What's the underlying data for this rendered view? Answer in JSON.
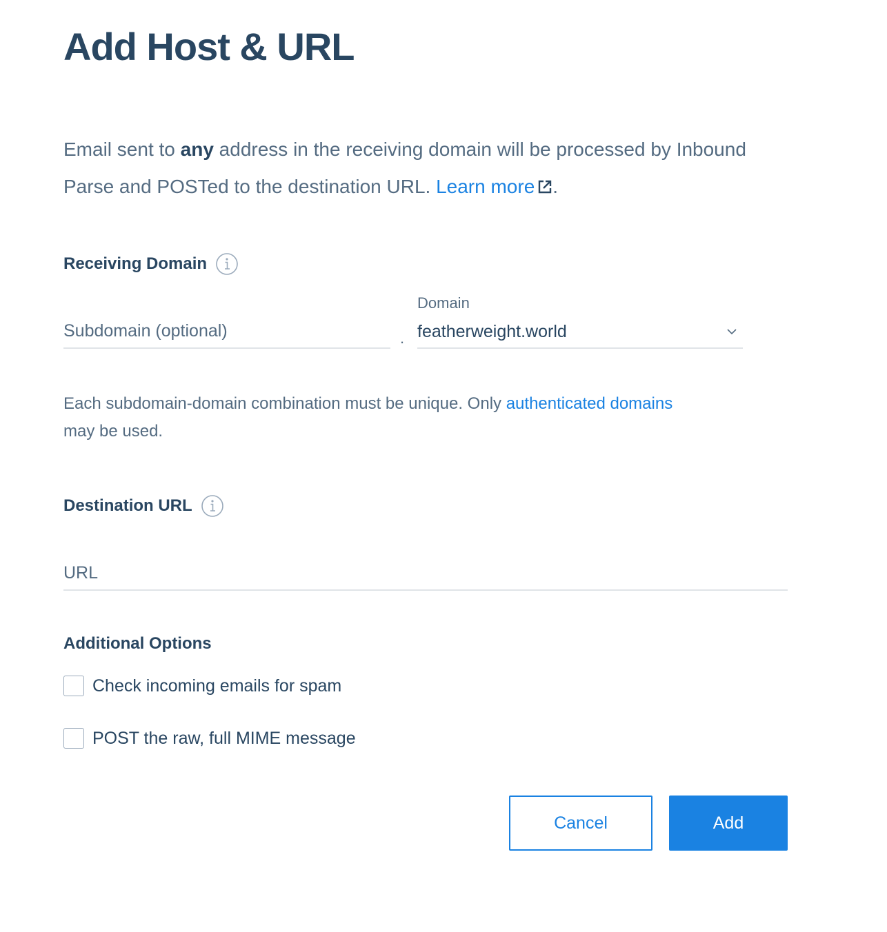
{
  "title": "Add Host & URL",
  "intro": {
    "part1": "Email sent to ",
    "bold": "any",
    "part2": " address in the receiving domain will be processed by Inbound Parse and POSTed to the destination URL. ",
    "link": "Learn more",
    "end": "."
  },
  "receiving_domain": {
    "label": "Receiving Domain",
    "subdomain_placeholder": "Subdomain (optional)",
    "separator": ".",
    "domain_label": "Domain",
    "domain_value": "featherweight.world",
    "help_text": "Each subdomain-domain combination must be unique. Only ",
    "help_link": "authenticated domains",
    "help_end": " may be used."
  },
  "destination": {
    "label": "Destination URL",
    "url_placeholder": "URL"
  },
  "options": {
    "label": "Additional Options",
    "items": [
      {
        "label": "Check incoming emails for spam",
        "checked": false
      },
      {
        "label": "POST the raw, full MIME message",
        "checked": false
      }
    ]
  },
  "buttons": {
    "cancel": "Cancel",
    "add": "Add"
  },
  "colors": {
    "heading": "#294661",
    "body_text": "#546b81",
    "link": "#1a82e2",
    "primary": "#1a82e2",
    "divider": "#e0e4e8"
  },
  "icons": {
    "info": "info-circle-icon",
    "external_link": "external-link-icon",
    "dropdown": "chevron-down-icon"
  }
}
